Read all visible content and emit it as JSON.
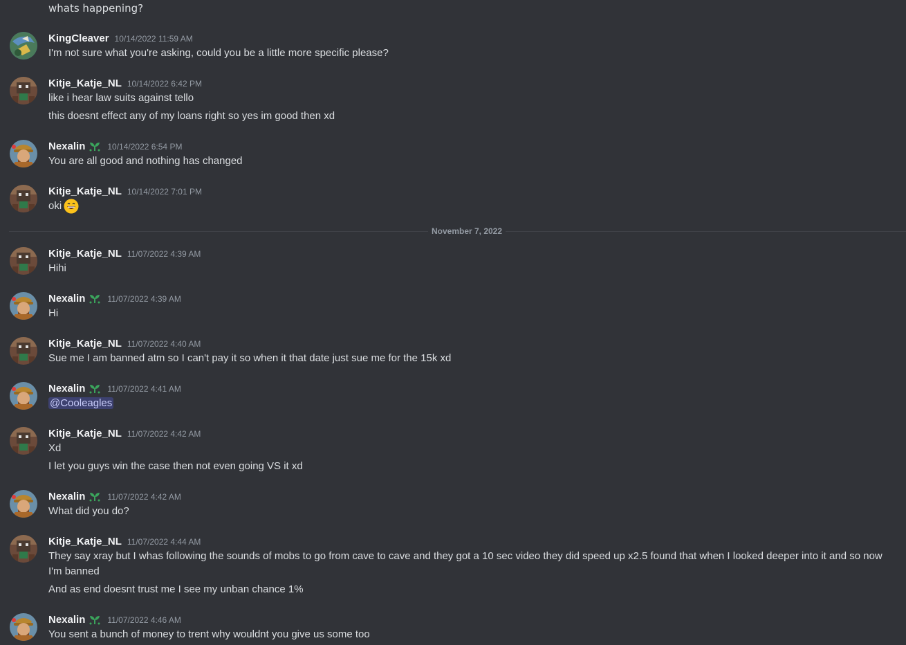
{
  "top_line": "whats happening?",
  "date_divider": "November 7, 2022",
  "colors": {
    "background": "#313338",
    "username": "#f2f3f5",
    "timestamp": "#949ba4",
    "text": "#dbdee1",
    "mention_bg": "#3c4270",
    "badge": "#3ba55c"
  },
  "messages": [
    {
      "author": "KingCleaver",
      "timestamp": "10/14/2022 11:59 AM",
      "avatar": "kingcleaver-avatar",
      "badge": false,
      "lines": [
        "I'm not sure what you're asking, could you be a little more specific please?"
      ]
    },
    {
      "author": "Kitje_Katje_NL",
      "timestamp": "10/14/2022 6:42 PM",
      "avatar": "kitje-avatar",
      "badge": false,
      "lines": [
        "like i hear law suits against tello",
        "this doesnt effect any of my loans right so yes im good then xd"
      ]
    },
    {
      "author": "Nexalin",
      "timestamp": "10/14/2022 6:54 PM",
      "avatar": "nexalin-avatar",
      "badge": true,
      "lines": [
        "You are all good and nothing has changed"
      ]
    },
    {
      "author": "Kitje_Katje_NL",
      "timestamp": "10/14/2022 7:01 PM",
      "avatar": "kitje-avatar",
      "badge": false,
      "lines": [
        "oki"
      ],
      "emoji": "grinning-face-emoji"
    },
    {
      "author": "Kitje_Katje_NL",
      "timestamp": "11/07/2022 4:39 AM",
      "avatar": "kitje-avatar",
      "badge": false,
      "lines": [
        "Hihi"
      ]
    },
    {
      "author": "Nexalin",
      "timestamp": "11/07/2022 4:39 AM",
      "avatar": "nexalin-avatar",
      "badge": true,
      "lines": [
        "Hi"
      ]
    },
    {
      "author": "Kitje_Katje_NL",
      "timestamp": "11/07/2022 4:40 AM",
      "avatar": "kitje-avatar",
      "badge": false,
      "lines": [
        "Sue me I am banned atm so I can't pay it so when it that date just sue me for the 15k xd"
      ]
    },
    {
      "author": "Nexalin",
      "timestamp": "11/07/2022 4:41 AM",
      "avatar": "nexalin-avatar",
      "badge": true,
      "mention": "@Cooleagles"
    },
    {
      "author": "Kitje_Katje_NL",
      "timestamp": "11/07/2022 4:42 AM",
      "avatar": "kitje-avatar",
      "badge": false,
      "lines": [
        "Xd",
        "I let you guys win the case then not even going VS it xd"
      ]
    },
    {
      "author": "Nexalin",
      "timestamp": "11/07/2022 4:42 AM",
      "avatar": "nexalin-avatar",
      "badge": true,
      "lines": [
        "What did you do?"
      ]
    },
    {
      "author": "Kitje_Katje_NL",
      "timestamp": "11/07/2022 4:44 AM",
      "avatar": "kitje-avatar",
      "badge": false,
      "lines": [
        "They say xray but I whas following the sounds of mobs to go from cave to cave and they got a 10 sec video they did speed up x2.5 found that when I looked deeper into it and so now I'm banned",
        "And as end doesnt trust me I see my unban chance 1%"
      ]
    },
    {
      "author": "Nexalin",
      "timestamp": "11/07/2022 4:46 AM",
      "avatar": "nexalin-avatar",
      "badge": true,
      "lines": [
        "You sent a bunch of money to trent why wouldnt you give us some too"
      ]
    }
  ]
}
